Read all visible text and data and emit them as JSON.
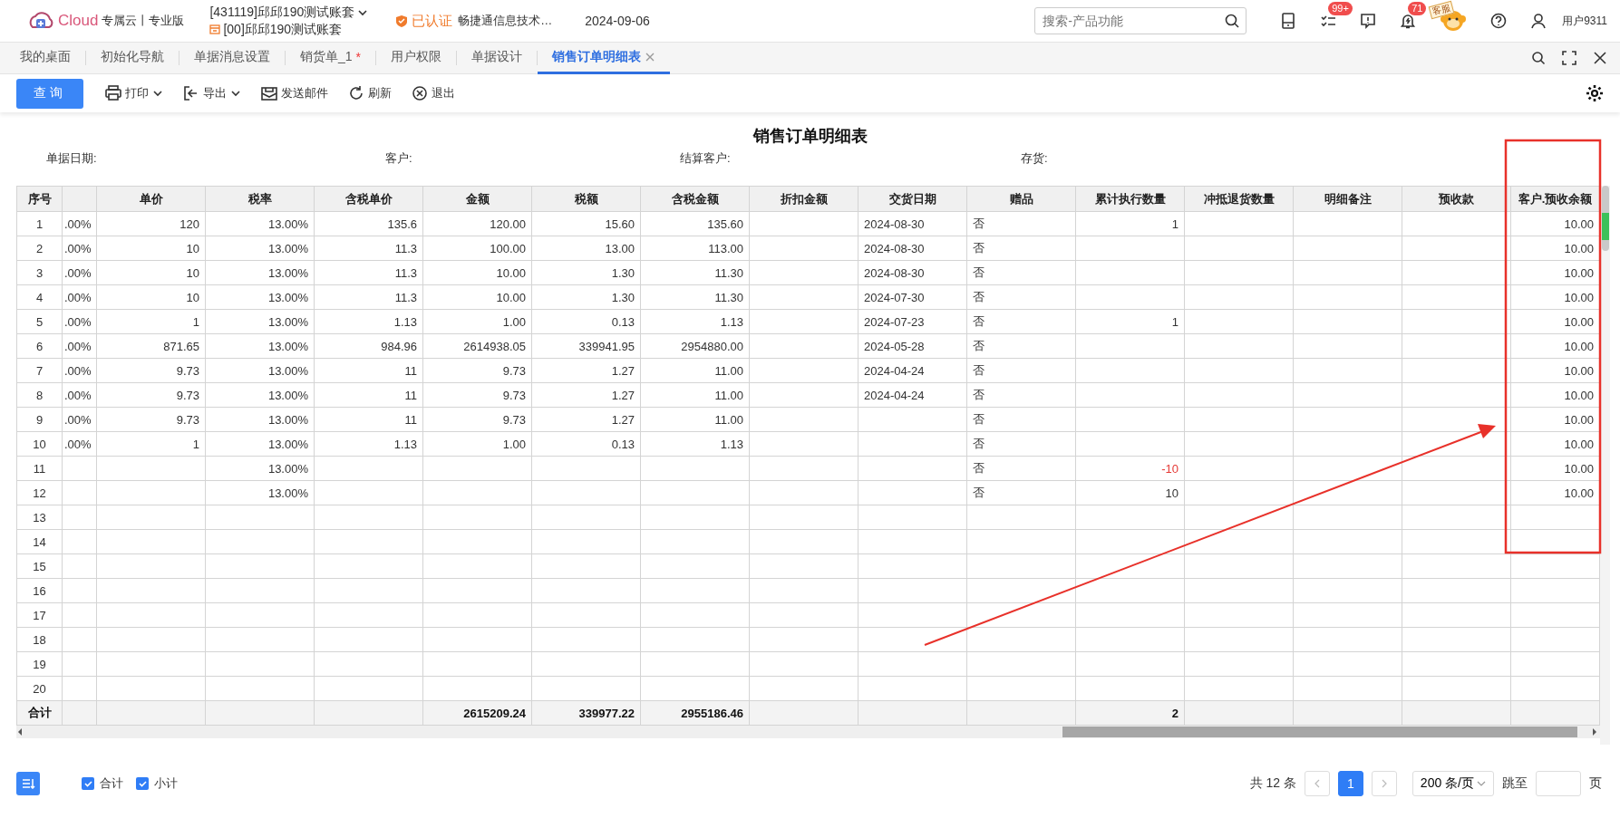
{
  "top_bar": {
    "logo_text": "Cloud",
    "edition": "专属云丨专业版",
    "accounts": [
      {
        "label": "[431119]邱邱190测试账套",
        "kind": "dropdown"
      },
      {
        "label": "[00]邱邱190测试账套",
        "kind": "ledger"
      }
    ],
    "certification": "已认证",
    "company": "畅捷通信息技术…",
    "date": "2024-09-06",
    "search": {
      "placeholder": "搜索-产品功能"
    },
    "icons": [
      {
        "kind": "device"
      },
      {
        "kind": "tasks",
        "badge": "99+"
      },
      {
        "kind": "message"
      },
      {
        "kind": "bell",
        "badge": "71"
      },
      {
        "kind": "service",
        "label": "客服"
      },
      {
        "kind": "help"
      },
      {
        "kind": "user"
      }
    ],
    "user": "用户9311"
  },
  "tabs": [
    {
      "label": "我的桌面",
      "selected": false
    },
    {
      "label": "初始化导航",
      "selected": false
    },
    {
      "label": "单据消息设置",
      "selected": false
    },
    {
      "label": "销货单_1",
      "selected": false,
      "marker": "*"
    },
    {
      "label": "用户权限",
      "selected": false
    },
    {
      "label": "单据设计",
      "selected": false
    },
    {
      "label": "销售订单明细表",
      "selected": true
    }
  ],
  "toolbar": {
    "query": "查询",
    "actions": [
      {
        "kind": "print",
        "label": "打印",
        "dropdown": true
      },
      {
        "kind": "export",
        "label": "导出",
        "dropdown": true
      },
      {
        "kind": "mail",
        "label": "发送邮件",
        "dropdown": false
      },
      {
        "kind": "refresh",
        "label": "刷新",
        "dropdown": false
      },
      {
        "kind": "exit",
        "label": "退出",
        "dropdown": false
      }
    ]
  },
  "report": {
    "title": "销售订单明细表",
    "filters": [
      "单据日期:",
      "客户:",
      "结算客户:",
      "存货:"
    ]
  },
  "table": {
    "columns": [
      "序号",
      null,
      "单价",
      "税率",
      "含税单价",
      "金额",
      "税额",
      "含税金额",
      "折扣金额",
      "交货日期",
      "赠品",
      "累计执行数量",
      "冲抵退货数量",
      "明细备注",
      "预收款",
      "客户.预收余额"
    ],
    "rows": [
      {
        "cells": [
          "1",
          ".00%",
          "120",
          "13.00%",
          "135.6",
          "120.00",
          "15.60",
          "135.60",
          null,
          "2024-08-30",
          "否",
          "1",
          null,
          null,
          null,
          "10.00"
        ]
      },
      {
        "cells": [
          "2",
          ".00%",
          "10",
          "13.00%",
          "11.3",
          "100.00",
          "13.00",
          "113.00",
          null,
          "2024-08-30",
          "否",
          null,
          null,
          null,
          null,
          "10.00"
        ]
      },
      {
        "cells": [
          "3",
          ".00%",
          "10",
          "13.00%",
          "11.3",
          "10.00",
          "1.30",
          "11.30",
          null,
          "2024-08-30",
          "否",
          null,
          null,
          null,
          null,
          "10.00"
        ]
      },
      {
        "cells": [
          "4",
          ".00%",
          "10",
          "13.00%",
          "11.3",
          "10.00",
          "1.30",
          "11.30",
          null,
          "2024-07-30",
          "否",
          null,
          null,
          null,
          null,
          "10.00"
        ]
      },
      {
        "cells": [
          "5",
          ".00%",
          "1",
          "13.00%",
          "1.13",
          "1.00",
          "0.13",
          "1.13",
          null,
          "2024-07-23",
          "否",
          "1",
          null,
          null,
          null,
          "10.00"
        ]
      },
      {
        "cells": [
          "6",
          ".00%",
          "871.65",
          "13.00%",
          "984.96",
          "2614938.05",
          "339941.95",
          "2954880.00",
          null,
          "2024-05-28",
          "否",
          null,
          null,
          null,
          null,
          "10.00"
        ]
      },
      {
        "cells": [
          "7",
          ".00%",
          "9.73",
          "13.00%",
          "11",
          "9.73",
          "1.27",
          "11.00",
          null,
          "2024-04-24",
          "否",
          null,
          null,
          null,
          null,
          "10.00"
        ]
      },
      {
        "cells": [
          "8",
          ".00%",
          "9.73",
          "13.00%",
          "11",
          "9.73",
          "1.27",
          "11.00",
          null,
          "2024-04-24",
          "否",
          null,
          null,
          null,
          null,
          "10.00"
        ]
      },
      {
        "cells": [
          "9",
          ".00%",
          "9.73",
          "13.00%",
          "11",
          "9.73",
          "1.27",
          "11.00",
          null,
          null,
          "否",
          null,
          null,
          null,
          null,
          "10.00"
        ]
      },
      {
        "cells": [
          "10",
          ".00%",
          "1",
          "13.00%",
          "1.13",
          "1.00",
          "0.13",
          "1.13",
          null,
          null,
          "否",
          null,
          null,
          null,
          null,
          "10.00"
        ]
      },
      {
        "cells": [
          "11",
          null,
          null,
          "13.00%",
          null,
          null,
          null,
          null,
          null,
          null,
          "否",
          {
            "text": "-10",
            "color": "#e53935"
          },
          null,
          null,
          null,
          "10.00"
        ]
      },
      {
        "cells": [
          "12",
          null,
          null,
          "13.00%",
          null,
          null,
          null,
          null,
          null,
          null,
          "否",
          "10",
          null,
          null,
          null,
          "10.00"
        ]
      },
      {
        "cells": [
          "13"
        ]
      },
      {
        "cells": [
          "14"
        ]
      },
      {
        "cells": [
          "15"
        ]
      },
      {
        "cells": [
          "16"
        ]
      },
      {
        "cells": [
          "17"
        ]
      },
      {
        "cells": [
          "18"
        ]
      },
      {
        "cells": [
          "19"
        ]
      },
      {
        "cells": [
          "20"
        ]
      }
    ],
    "total": {
      "label": "合计",
      "amount": "2615209.24",
      "tax": "339977.22",
      "amount_with_tax": "2955186.46",
      "exec_qty": "2"
    }
  },
  "footer": {
    "options": [
      {
        "label": "合计",
        "checked": true
      },
      {
        "label": "小计",
        "checked": true
      }
    ],
    "total": "共 12 条",
    "pages": [
      {
        "label": "1",
        "selected": true
      }
    ],
    "page_size": "200 条/页",
    "jump_label": "跳至",
    "page_unit": "页"
  }
}
